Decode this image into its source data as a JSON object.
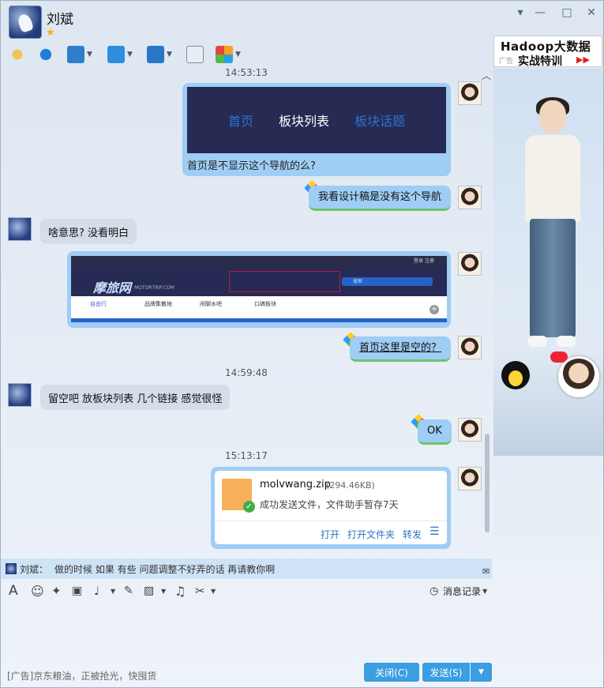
{
  "contact": {
    "name": "刘斌"
  },
  "ad_banner": {
    "line1": "Hadoop大数据",
    "line2": "实战特训",
    "tag": "广告"
  },
  "toolbar": {
    "items": [
      "mic-icon",
      "video-icon",
      "screen-share-icon",
      "file-transfer-icon",
      "remote-desktop-icon",
      "add-app-icon",
      "more-apps-icon"
    ]
  },
  "messages": [
    {
      "type": "time",
      "text": "14:53:13"
    },
    {
      "type": "image_nav",
      "nav": [
        "首页",
        "板块列表",
        "板块话题"
      ],
      "caption": "首页是不显示这个导航的么?"
    },
    {
      "type": "me",
      "text": "我看设计稿是没有这个导航"
    },
    {
      "type": "other",
      "text": "啥意思?  没看明白"
    },
    {
      "type": "image_site",
      "links": [
        "登录",
        "注册"
      ],
      "logo": "摩旅网",
      "logo_url": "MOTORTRIP.COM",
      "search": "搜索",
      "tabs": [
        "自由行",
        "品牌集散地",
        "闲聊水吧",
        "口碑板块"
      ]
    },
    {
      "type": "me",
      "text": "首页这里是空的？"
    },
    {
      "type": "time",
      "text": "14:59:48"
    },
    {
      "type": "other",
      "text": "留空吧 放板块列表 几个链接 感觉很怪"
    },
    {
      "type": "me",
      "text": "OK"
    },
    {
      "type": "time",
      "text": "15:13:17"
    },
    {
      "type": "file",
      "filename": "molvwang.zip",
      "size": "(294.46KB)",
      "status": "成功发送文件，文件助手暂存7天",
      "actions": [
        "打开",
        "打开文件夹",
        "转发"
      ]
    }
  ],
  "status_line": {
    "sender": "刘斌：",
    "text": "做的时候 如果 有些 问题调整不好弄的话 再请教你啊"
  },
  "input_toolbar": {
    "history_label": "消息记录"
  },
  "footer": {
    "ad": "[广告]京东粮油，正被抢光，快囤货",
    "close": "关闭(C)",
    "send": "发送(S)"
  }
}
